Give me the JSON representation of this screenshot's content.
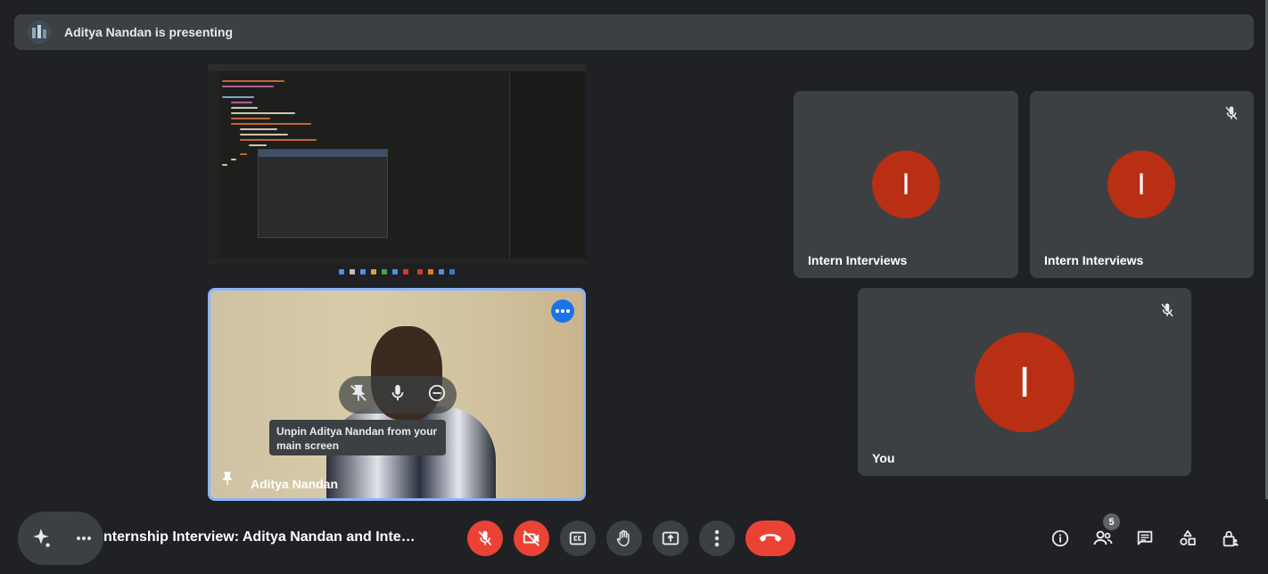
{
  "banner": {
    "presenter_text": "Aditya Nandan is presenting"
  },
  "pinned_video": {
    "name": "Aditya Nandan",
    "tooltip": "Unpin Aditya Nandan from your main screen"
  },
  "participants": [
    {
      "initial": "I",
      "name": "Intern Interviews",
      "muted": false
    },
    {
      "initial": "I",
      "name": "Intern Interviews",
      "muted": true
    },
    {
      "initial": "I",
      "name": "You",
      "muted": true
    }
  ],
  "meeting": {
    "title": "nternship Interview: Aditya Nandan and Inter..."
  },
  "people": {
    "count": "5"
  },
  "colors": {
    "background": "#202124",
    "tile": "#3c4043",
    "avatar": "#b92f13",
    "danger": "#ea4335",
    "accent": "#8ab4f8"
  }
}
